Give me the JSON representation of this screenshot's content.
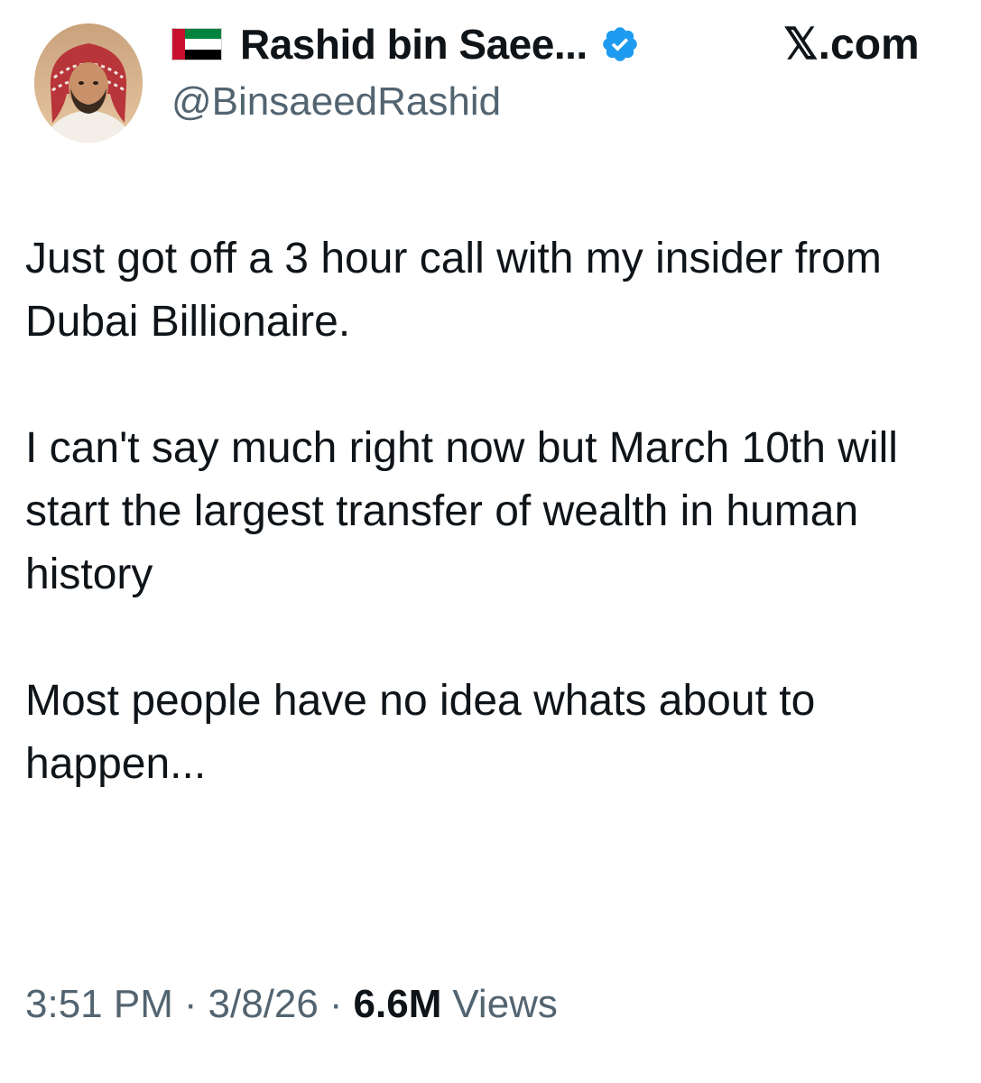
{
  "author": {
    "display_name": "Rashid bin Saee...",
    "handle": "@BinsaeedRashid",
    "flag_icon": "uae-flag-icon",
    "verified_icon": "verified-badge-icon",
    "verified_color": "#1d9bf0"
  },
  "source": {
    "domain": "𝕏.com"
  },
  "tweet": {
    "paragraphs": [
      "Just got off a 3 hour call with my insider from Dubai Billionaire.",
      "I can't say much right now but March 10th will start the largest transfer of wealth in human history",
      "Most people have no idea whats about to happen..."
    ]
  },
  "meta": {
    "time": "3:51 PM",
    "separator": "·",
    "date": "3/8/26",
    "views_count": "6.6M",
    "views_label": "Views"
  },
  "colors": {
    "text_primary": "#0f1419",
    "text_secondary": "#536471",
    "background": "#ffffff"
  }
}
